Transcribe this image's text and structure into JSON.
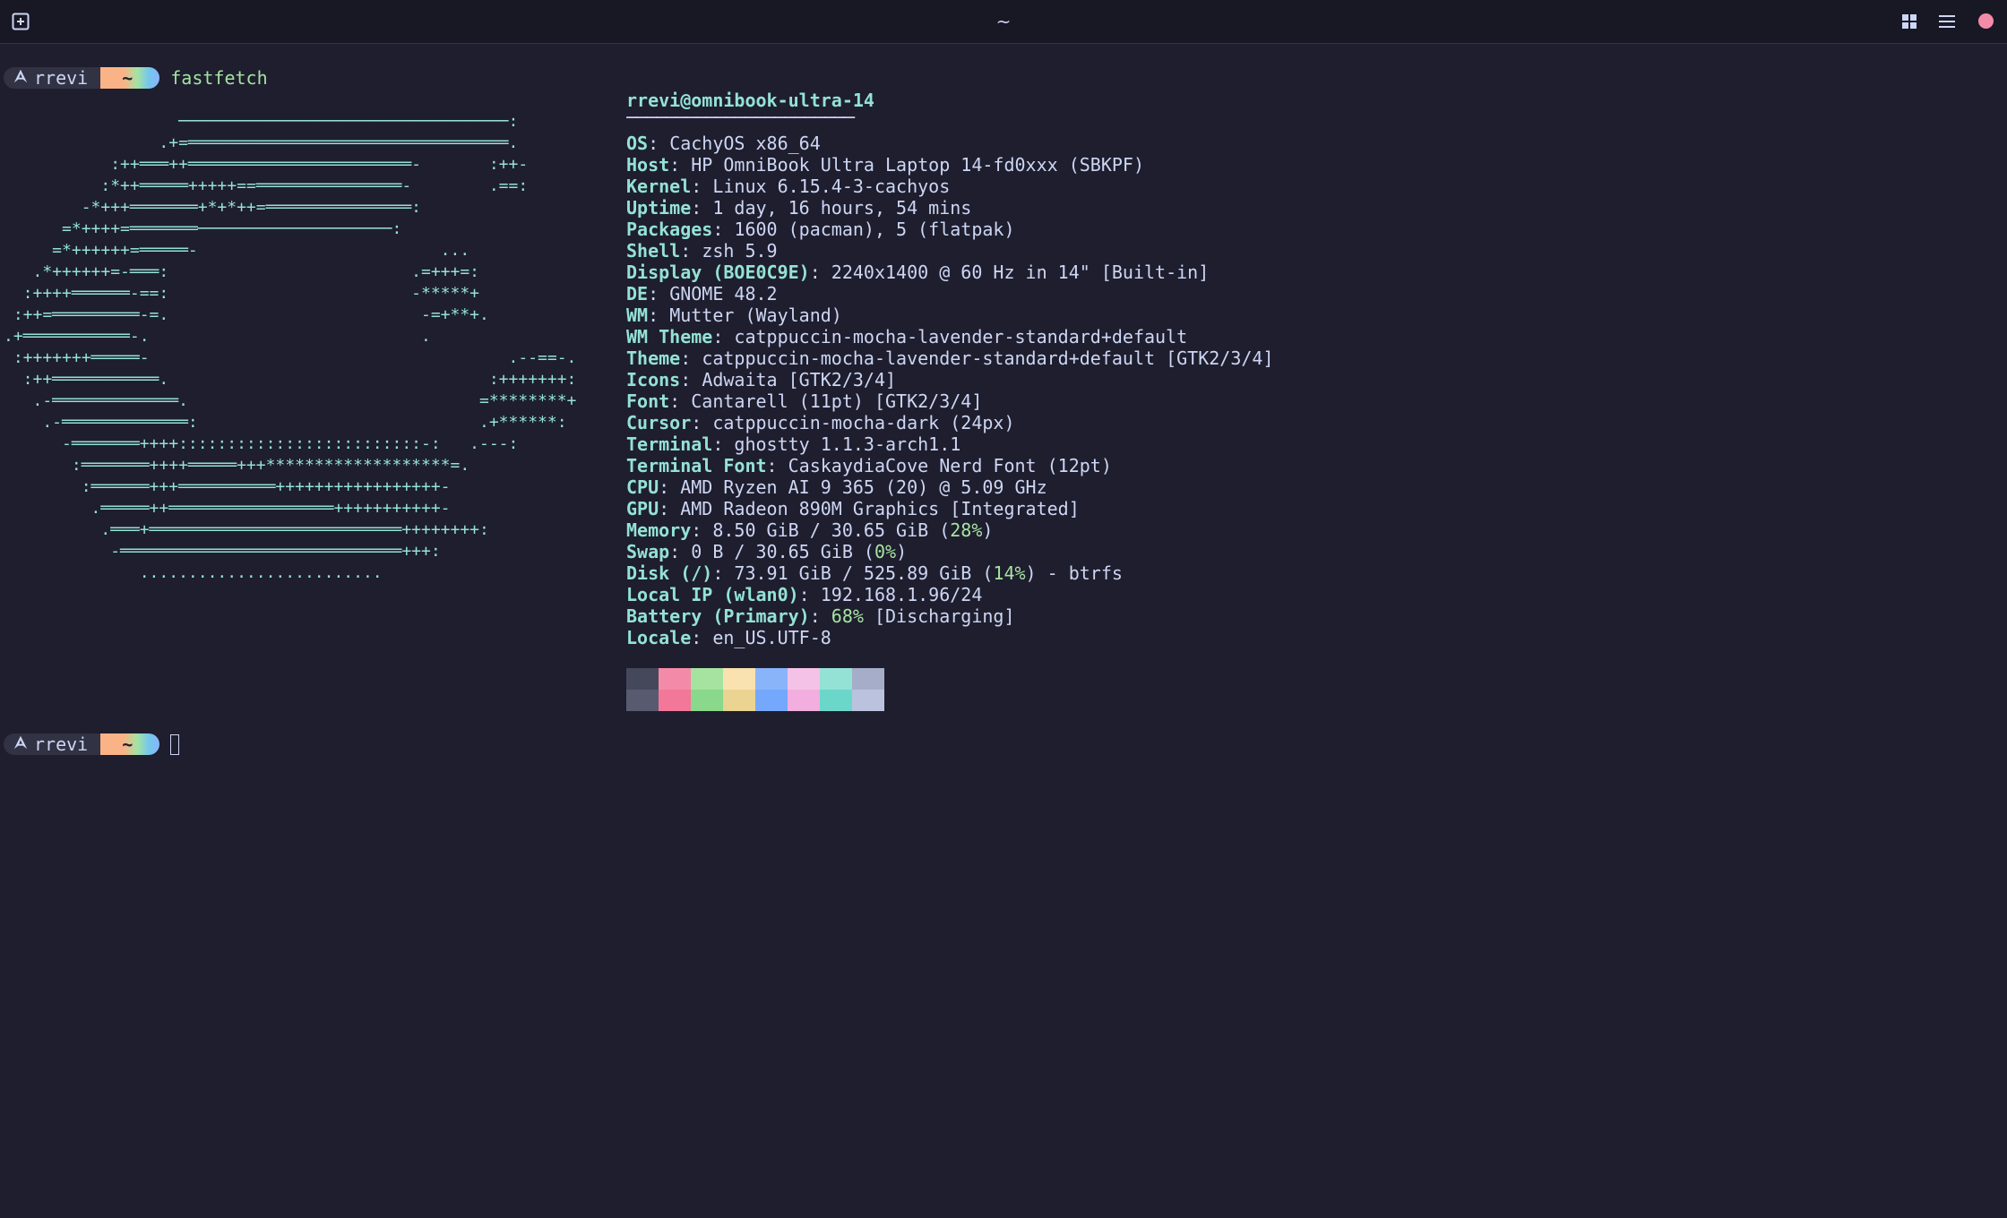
{
  "window": {
    "title": "~"
  },
  "colors": {
    "background": "#1e1e2e",
    "titlebar": "#181825",
    "accent": "#94e2d5",
    "text": "#cdd6f4",
    "highlight": "#a6e3a1",
    "close": "#f38ba8"
  },
  "icons": {
    "new_tab": "new-tab-icon",
    "layout": "grid-icon",
    "menu": "hamburger-menu-icon",
    "close": "close-dot-icon",
    "os": "arch-logo-icon"
  },
  "prompt": {
    "user": "rrevi",
    "dir": "~"
  },
  "command": "fastfetch",
  "logo_lines": [
    "                                ",
    "                  ──────────────────────────────────:",
    "                .+=═════════════════════════════════.",
    "           :++═══++═══════════════════════-       :++-",
    "          :*++═════+++++==═══════════════-        .==:",
    "        -*+++═══════+*+*++=═══════════════:",
    "      =*++++=═══════────────────────────:",
    "     =*++++++=═════-                         ...",
    "   .*++++++=-═══:                         .=+++=:",
    "  :++++══════-==:                         -*****+",
    " :++=═════════-=.                          -=+**+.",
    ".+═══════════-.                            .",
    " :+++++++═════-                                     .--==-.",
    "  :++═══════════.                                 :+++++++:",
    "   .-═════════════.                              =********+",
    "    .-═════════════:                             .+******:",
    "      -═══════++++:::::::::::::::::::::::::-:   .---:",
    "       :═══════++++═════+++*******************=.",
    "        :══════+++══════════+++++++++++++++++-",
    "         .═════++═════════════════+++++++++++-",
    "          .═══+══════════════════════════++++++++:",
    "           -═════════════════════════════+++:",
    "              ........................."
  ],
  "info": {
    "title": "rrevi@omnibook-ultra-14",
    "separator": "───────────────────────",
    "rows": [
      {
        "key": "OS",
        "value": "CachyOS x86_64"
      },
      {
        "key": "Host",
        "value": "HP OmniBook Ultra Laptop 14-fd0xxx (SBKPF)"
      },
      {
        "key": "Kernel",
        "value": "Linux 6.15.4-3-cachyos"
      },
      {
        "key": "Uptime",
        "value": "1 day, 16 hours, 54 mins"
      },
      {
        "key": "Packages",
        "value": "1600 (pacman), 5 (flatpak)"
      },
      {
        "key": "Shell",
        "value": "zsh 5.9"
      },
      {
        "key": "Display (BOE0C9E)",
        "value": "2240x1400 @ 60 Hz in 14\" [Built-in]"
      },
      {
        "key": "DE",
        "value": "GNOME 48.2"
      },
      {
        "key": "WM",
        "value": "Mutter (Wayland)"
      },
      {
        "key": "WM Theme",
        "value": "catppuccin-mocha-lavender-standard+default"
      },
      {
        "key": "Theme",
        "value": "catppuccin-mocha-lavender-standard+default [GTK2/3/4]"
      },
      {
        "key": "Icons",
        "value": "Adwaita [GTK2/3/4]"
      },
      {
        "key": "Font",
        "value": "Cantarell (11pt) [GTK2/3/4]"
      },
      {
        "key": "Cursor",
        "value": "catppuccin-mocha-dark (24px)"
      },
      {
        "key": "Terminal",
        "value": "ghostty 1.1.3-arch1.1"
      },
      {
        "key": "Terminal Font",
        "value": "CaskaydiaCove Nerd Font (12pt)"
      },
      {
        "key": "CPU",
        "value": "AMD Ryzen AI 9 365 (20) @ 5.09 GHz"
      },
      {
        "key": "GPU",
        "value": "AMD Radeon 890M Graphics [Integrated]"
      },
      {
        "key": "Memory",
        "pre": "8.50 GiB / 30.65 GiB (",
        "pct": "28%",
        "post": ")"
      },
      {
        "key": "Swap",
        "pre": "0 B / 30.65 GiB (",
        "pct": "0%",
        "post": ")"
      },
      {
        "key": "Disk (/)",
        "pre": "73.91 GiB / 525.89 GiB (",
        "pct": "14%",
        "post": ") - btrfs"
      },
      {
        "key": "Local IP (wlan0)",
        "value": "192.168.1.96/24"
      },
      {
        "key": "Battery (Primary)",
        "pre": "",
        "pct": "68%",
        "post": " [Discharging]"
      },
      {
        "key": "Locale",
        "value": "en_US.UTF-8"
      }
    ]
  },
  "palette": {
    "top": [
      "#45475a",
      "#f38ba8",
      "#a6e3a1",
      "#f9e2af",
      "#89b4fa",
      "#f5c2e7",
      "#94e2d5",
      "#a6adc8"
    ],
    "bottom": [
      "#585b70",
      "#f37799",
      "#89d88b",
      "#ebd391",
      "#74a8fc",
      "#f2aede",
      "#6bd7ca",
      "#bac2de"
    ]
  }
}
